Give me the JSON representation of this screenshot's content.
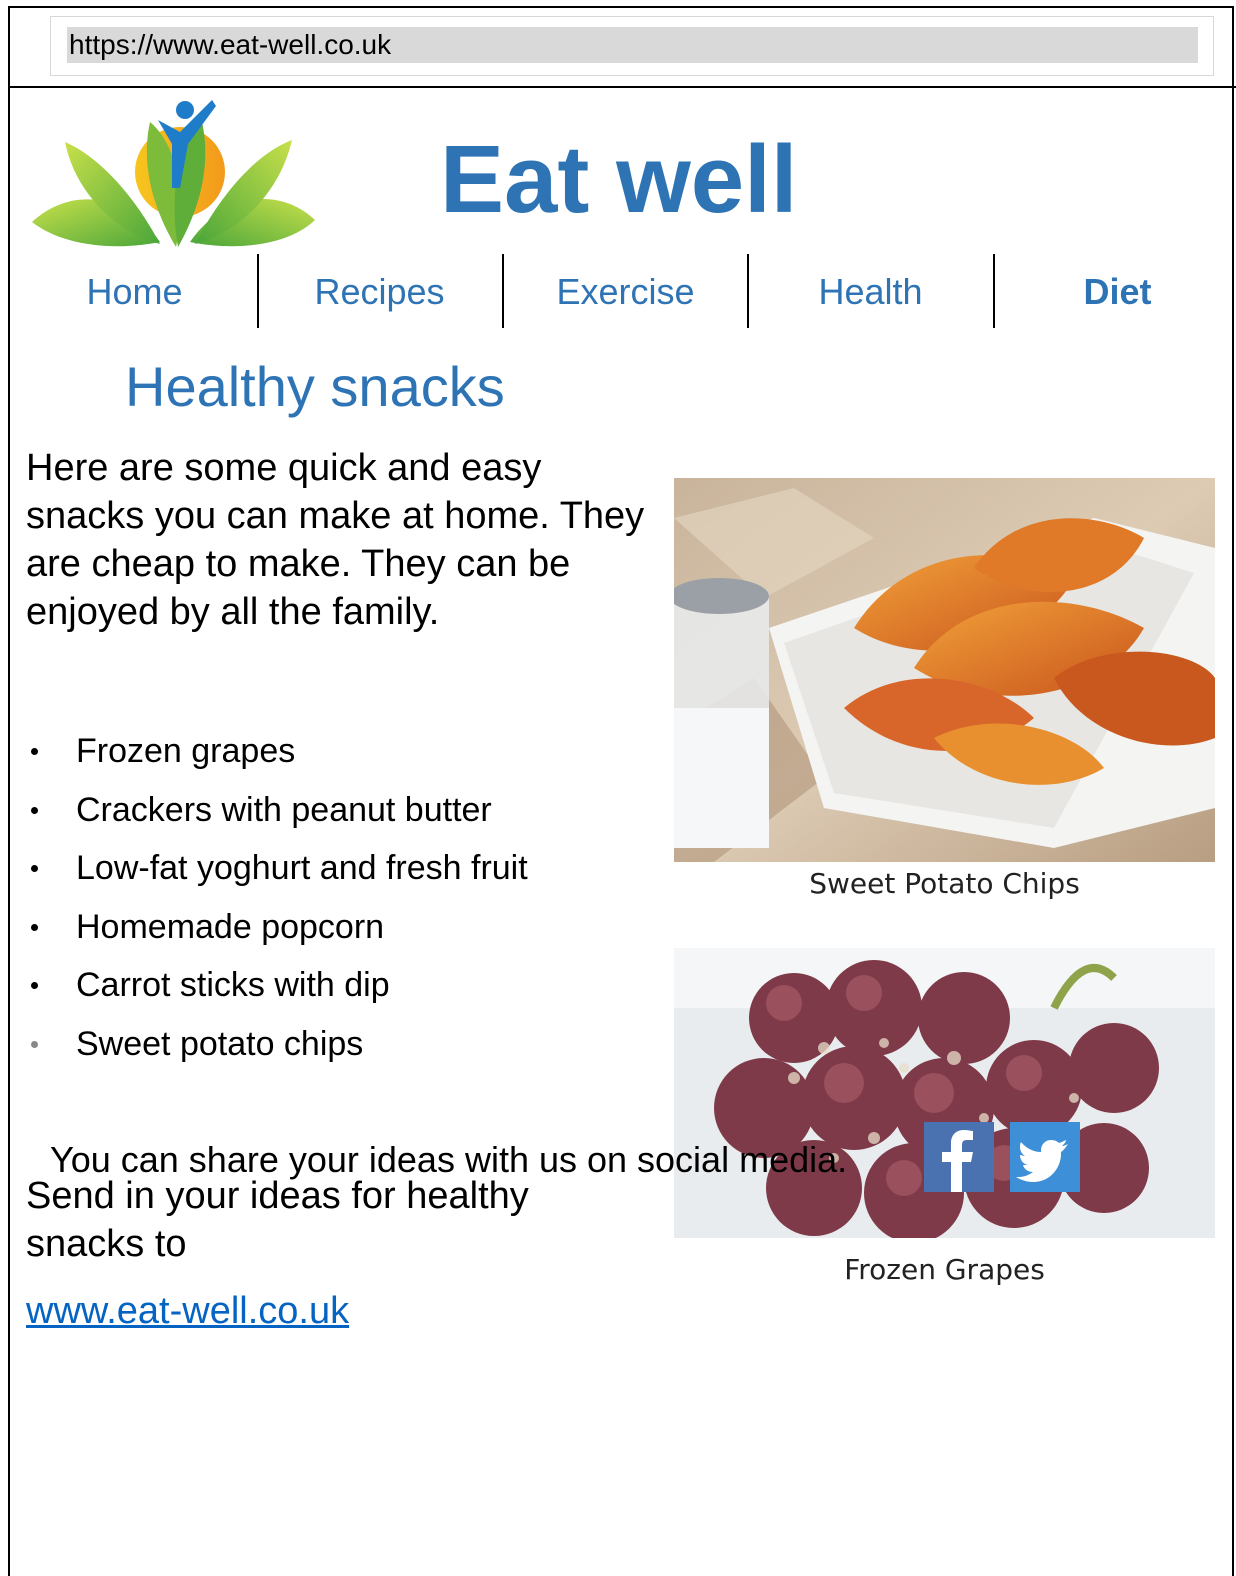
{
  "browser": {
    "url": "https://www.eat-well.co.uk"
  },
  "site": {
    "title": "Eat well"
  },
  "nav": {
    "items": [
      {
        "label": "Home"
      },
      {
        "label": "Recipes"
      },
      {
        "label": "Exercise"
      },
      {
        "label": "Health"
      },
      {
        "label": "Diet"
      }
    ],
    "active": "Diet"
  },
  "main": {
    "title": "Healthy snacks",
    "intro": "Here are some quick and easy snacks you can make at home. They are cheap to make. They can be enjoyed by all the family.",
    "snacks": [
      "Frozen grapes",
      "Crackers with peanut butter",
      "Low-fat yoghurt and fresh fruit",
      "Homemade popcorn",
      "Carrot sticks with dip",
      "Sweet potato chips"
    ],
    "send_text": "Send in your ideas for healthy snacks to",
    "link": "www.eat-well.co.uk"
  },
  "images": {
    "chips_caption": "Sweet Potato Chips",
    "grapes_caption": "Frozen Grapes"
  },
  "social": {
    "text": "You can share your ideas with us on social media.",
    "icons": [
      "facebook-icon",
      "twitter-icon"
    ],
    "colors": {
      "facebook": "#4b72b0",
      "twitter": "#3d90d8"
    }
  },
  "colors": {
    "brand_blue": "#2e74b5",
    "link": "#0563c1"
  }
}
